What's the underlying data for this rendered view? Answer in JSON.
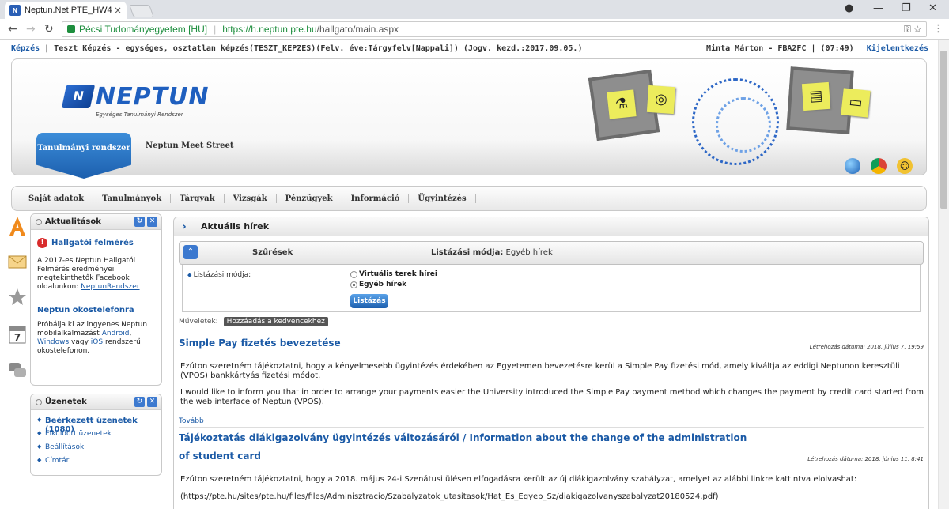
{
  "browser": {
    "tab_title": "Neptun.Net PTE_HW4",
    "tab_close": "×",
    "secure_label": "Pécsi Tudományegyetem [HU]",
    "url_host": "https://h.neptun.pte.hu",
    "url_path": "/hallgato/main.aspx"
  },
  "infobar": {
    "training_link": "Képzés",
    "training_text": " |  Teszt Képzés - egységes, osztatlan képzés(TESZT_KEPZES)(Felv. éve:Tárgyfelv[Nappali]) (Jogv. kezd.:2017.09.05.)",
    "user": "Minta Márton - FBA2FC  |  (07:49)",
    "logout": "Kijelentkezés"
  },
  "banner": {
    "logo_text": "NEPTUN",
    "logo_sub": "Egységes Tanulmányi Rendszer",
    "tab_active": "Tanulmányi rendszer",
    "tab_other": "Neptun Meet Street"
  },
  "menu": [
    "Saját adatok",
    "Tanulmányok",
    "Tárgyak",
    "Vizsgák",
    "Pénzügyek",
    "Információ",
    "Ügyintézés"
  ],
  "news_box": {
    "title": "Aktualitások",
    "item1_title": "Hallgatói felmérés",
    "item1_body": "A 2017-es Neptun Hallgatói Felmérés eredményei megtekinthetők Facebook oldalunkon: ",
    "item1_link": "NeptunRendszer",
    "item2_title": "Neptun okostelefonra",
    "item2_body_a": "Próbálja ki az ingyenes Neptun mobilalkalmazást ",
    "item2_android": "Android",
    "item2_comma": ",",
    "item2_windows": "Windows",
    "item2_or": " vagy ",
    "item2_ios": "iOS",
    "item2_body_b": " rendszerű okostelefonon."
  },
  "messages_box": {
    "title": "Üzenetek",
    "items": [
      "Beérkezett üzenetek (1080)",
      "Elküldött üzenetek",
      "Beállítások",
      "Címtár"
    ]
  },
  "content": {
    "title": "Aktuális hírek",
    "filter_title": "Szűrések",
    "filter_mode_label": "Listázási módja:",
    "filter_mode_value": " Egyéb hírek",
    "fb_label": "Listázási módja:",
    "radio1": "Virtuális terek hírei",
    "radio2": "Egyéb hírek",
    "list_button": "Listázás",
    "ops_label": "Műveletek:",
    "fav_button": "Hozzáadás a kedvencekhez",
    "article1": {
      "title": "Simple Pay fizetés bevezetése",
      "date": "Létrehozás dátuma: 2018. július 7. 19:59",
      "para1": "Ezúton szeretném tájékoztatni, hogy a kényelmesebb ügyintézés érdekében az Egyetemen bevezetésre kerül a Simple Pay fizetési mód, amely kiváltja az eddigi Neptunon keresztüli (VPOS) bankkártyás fizetési módot.",
      "para2": "I would like to inform you that in order to arrange your payments easier the University introduced the Simple Pay payment method which changes the payment by credit card started from the web interface of Neptun (VPOS).",
      "more": "Tovább"
    },
    "article2": {
      "title_line1": "Tájékoztatás diákigazolvány ügyintézés változásáról / Information about the change of the administration",
      "title_line2": "of student card",
      "date": "Létrehozás dátuma: 2018. június 11. 8:41",
      "para1": "Ezúton szeretném tájékoztatni, hogy a 2018. május 24-i Szenátusi ülésen elfogadásra került az új diákigazolvány szabályzat, amelyet az alábbi linkre kattintva elolvashat:",
      "para2": "(https://pte.hu/sites/pte.hu/files/files/Adminisztracio/Szabalyzatok_utasitasok/Hat_Es_Egyeb_Sz/diakigazolvanyszabalyzat20180524.pdf)"
    }
  }
}
